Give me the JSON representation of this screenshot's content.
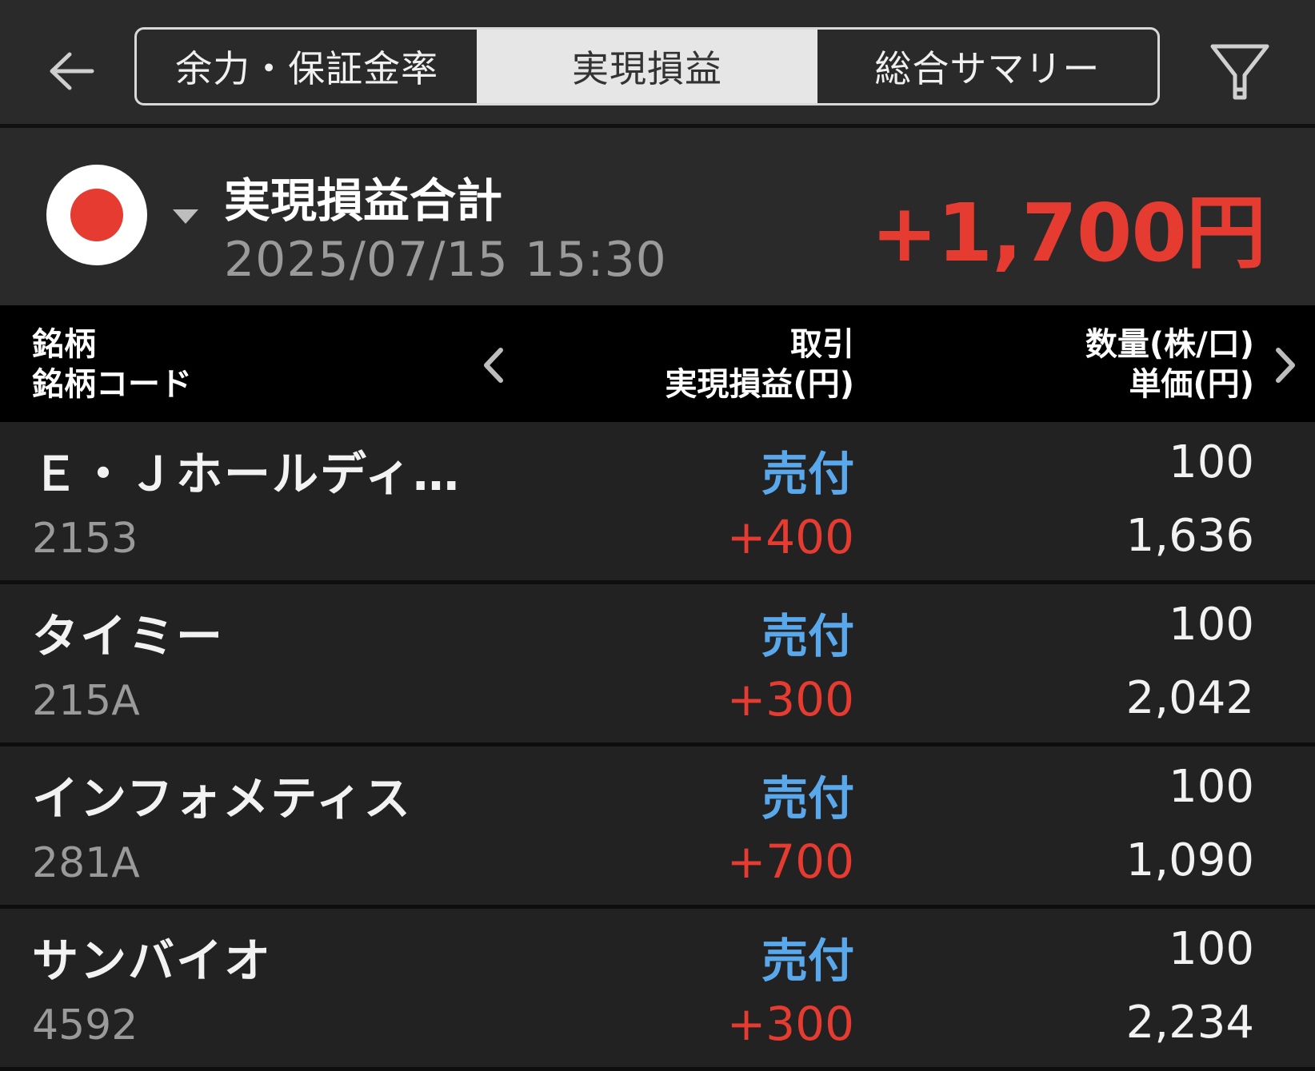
{
  "header": {
    "back_icon": "back-arrow-icon",
    "filter_icon": "filter-icon",
    "tabs": [
      {
        "label": "余力・保証金率",
        "active": false
      },
      {
        "label": "実現損益",
        "active": true
      },
      {
        "label": "総合サマリー",
        "active": false
      }
    ]
  },
  "summary": {
    "market_icon": "japan-flag-icon",
    "title": "実現損益合計",
    "datetime": "2025/07/15  15:30",
    "total": "+1,700円"
  },
  "columns": {
    "left_line1": "銘柄",
    "left_line2": "銘柄コード",
    "mid_line1": "取引",
    "mid_line2": "実現損益(円)",
    "right_line1": "数量(株/口)",
    "right_line2": "単価(円)"
  },
  "rows": [
    {
      "name": "Ｅ・Ｊホールディ…",
      "code": "2153",
      "trade": "売付",
      "pnl": "+400",
      "quantity": "100",
      "price": "1,636"
    },
    {
      "name": "タイミー",
      "code": "215A",
      "trade": "売付",
      "pnl": "+300",
      "quantity": "100",
      "price": "2,042"
    },
    {
      "name": "インフォメティス",
      "code": "281A",
      "trade": "売付",
      "pnl": "+700",
      "quantity": "100",
      "price": "1,090"
    },
    {
      "name": "サンバイオ",
      "code": "4592",
      "trade": "売付",
      "pnl": "+300",
      "quantity": "100",
      "price": "2,234"
    }
  ],
  "colors": {
    "positive": "#e63b30",
    "sell": "#5aa8ec",
    "background": "#1c1c1c"
  }
}
